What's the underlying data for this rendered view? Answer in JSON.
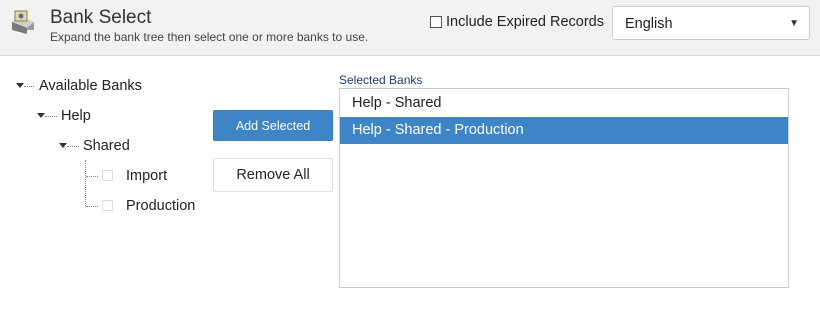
{
  "header": {
    "icon": "bank-icon",
    "title": "Bank Select",
    "subtitle": "Expand the bank tree then select one or more banks to use.",
    "include_expired_label": "Include Expired Records",
    "include_expired_checked": false,
    "language": {
      "selected": "English"
    }
  },
  "tree": {
    "root": "Available Banks",
    "child": "Help",
    "grandchild": "Shared",
    "leaves": [
      "Import",
      "Production"
    ]
  },
  "actions": {
    "add_selected": "Add Selected",
    "remove_all": "Remove All"
  },
  "selected_banks": {
    "label": "Selected Banks",
    "items": [
      {
        "label": "Help - Shared",
        "selected": false
      },
      {
        "label": "Help - Shared - Production",
        "selected": true
      }
    ]
  },
  "colors": {
    "accent": "#3d85c6",
    "header_bg": "#f2f2f2",
    "label_blue": "#1d3f73"
  }
}
